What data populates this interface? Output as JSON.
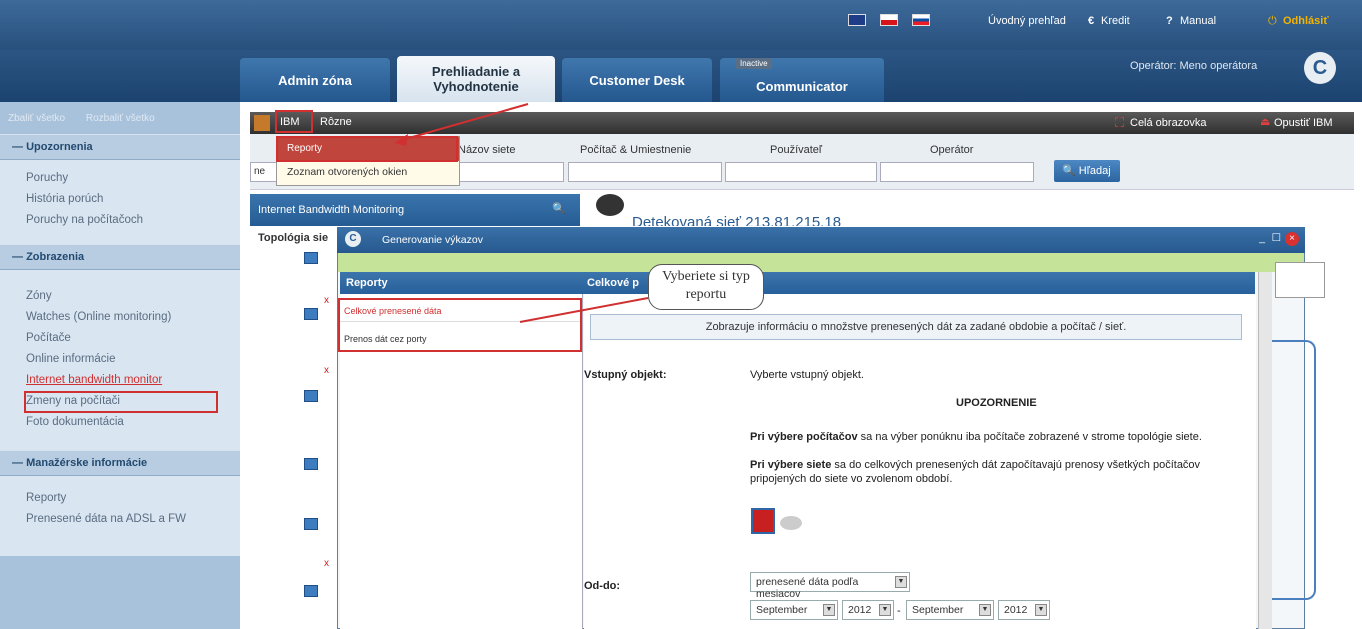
{
  "top_links": {
    "overview": "Úvodný prehľad",
    "credit": "Kredit",
    "manual": "Manual",
    "logout": "Odhlásiť",
    "operator": "Operátor: Meno operátora"
  },
  "tabs": [
    {
      "label": "Admin zóna"
    },
    {
      "label": "Prehliadanie a Vyhodnotenie"
    },
    {
      "label": "Customer Desk"
    },
    {
      "label": "Communicator",
      "badge": "Inactive"
    }
  ],
  "sidebar": {
    "collapse_all": "Zbaliť všetko",
    "expand_all": "Rozbaliť všetko",
    "sections": [
      {
        "title": "Upozornenia",
        "items": [
          "Poruchy",
          "História porúch",
          "Poruchy na počítačoch"
        ]
      },
      {
        "title": "Zobrazenia",
        "items": [
          "Zóny",
          "Watches (Online monitoring)",
          "Počítače",
          "Online informácie",
          "Internet bandwidth monitor",
          "Zmeny na počítači",
          "Foto dokumentácia"
        ]
      },
      {
        "title": "Manažérske informácie",
        "items": [
          "Reporty",
          "Prenesené dáta na ADSL a FW"
        ]
      }
    ]
  },
  "ibm_bar": {
    "menu_ibm": "IBM",
    "menu_misc": "Rôzne",
    "fullscreen": "Celá obrazovka",
    "leave": "Opustiť IBM",
    "dropdown": [
      "Reporty",
      "Zoznam otvorených okien"
    ]
  },
  "search": {
    "network_name": "Názov siete",
    "pc_location": "Počítač & Umiestnenie",
    "user": "Používateľ",
    "operator": "Operátor",
    "search_btn": "Hľadaj",
    "first_value": "ne"
  },
  "left_panel": {
    "bw_title": "Internet Bandwidth Monitoring",
    "topology": "Topológia sie"
  },
  "detected": "Detekovaná sieť 213.81.215.18",
  "dialog": {
    "title": "Generovanie výkazov",
    "left_head": "Reporty",
    "reports": [
      "Celkové prenesené dáta",
      "Prenos dát cez porty"
    ],
    "right_head": "Celkové p",
    "callout_line1": "Vyberiete si typ",
    "callout_line2": "reportu",
    "info": "Zobrazuje informáciu o množstve prenesených dát za zadané obdobie a počítač / sieť.",
    "input_label": "Vstupný objekt:",
    "input_value": "Vyberte vstupný objekt.",
    "warning_title": "UPOZORNENIE",
    "warn1_bold": "Pri výbere počítačov",
    "warn1_rest": " sa na výber ponúknu iba počítače zobrazené v strome topológie siete.",
    "warn2_bold": "Pri výbere siete",
    "warn2_rest": " sa do celkových prenesených dát započítavajú prenosy všetkých počítačov pripojených do siete vo zvolenom období.",
    "range_label": "Od-do:",
    "range_mode": "prenesené dáta podľa mesiacov",
    "month_from": "September",
    "year_from": "2012",
    "month_to": "September",
    "year_to": "2012",
    "dash": "-"
  },
  "colors": {
    "accent": "#2a5b90",
    "highlight_red": "#d03030",
    "active_tab": "#e6eef6"
  }
}
